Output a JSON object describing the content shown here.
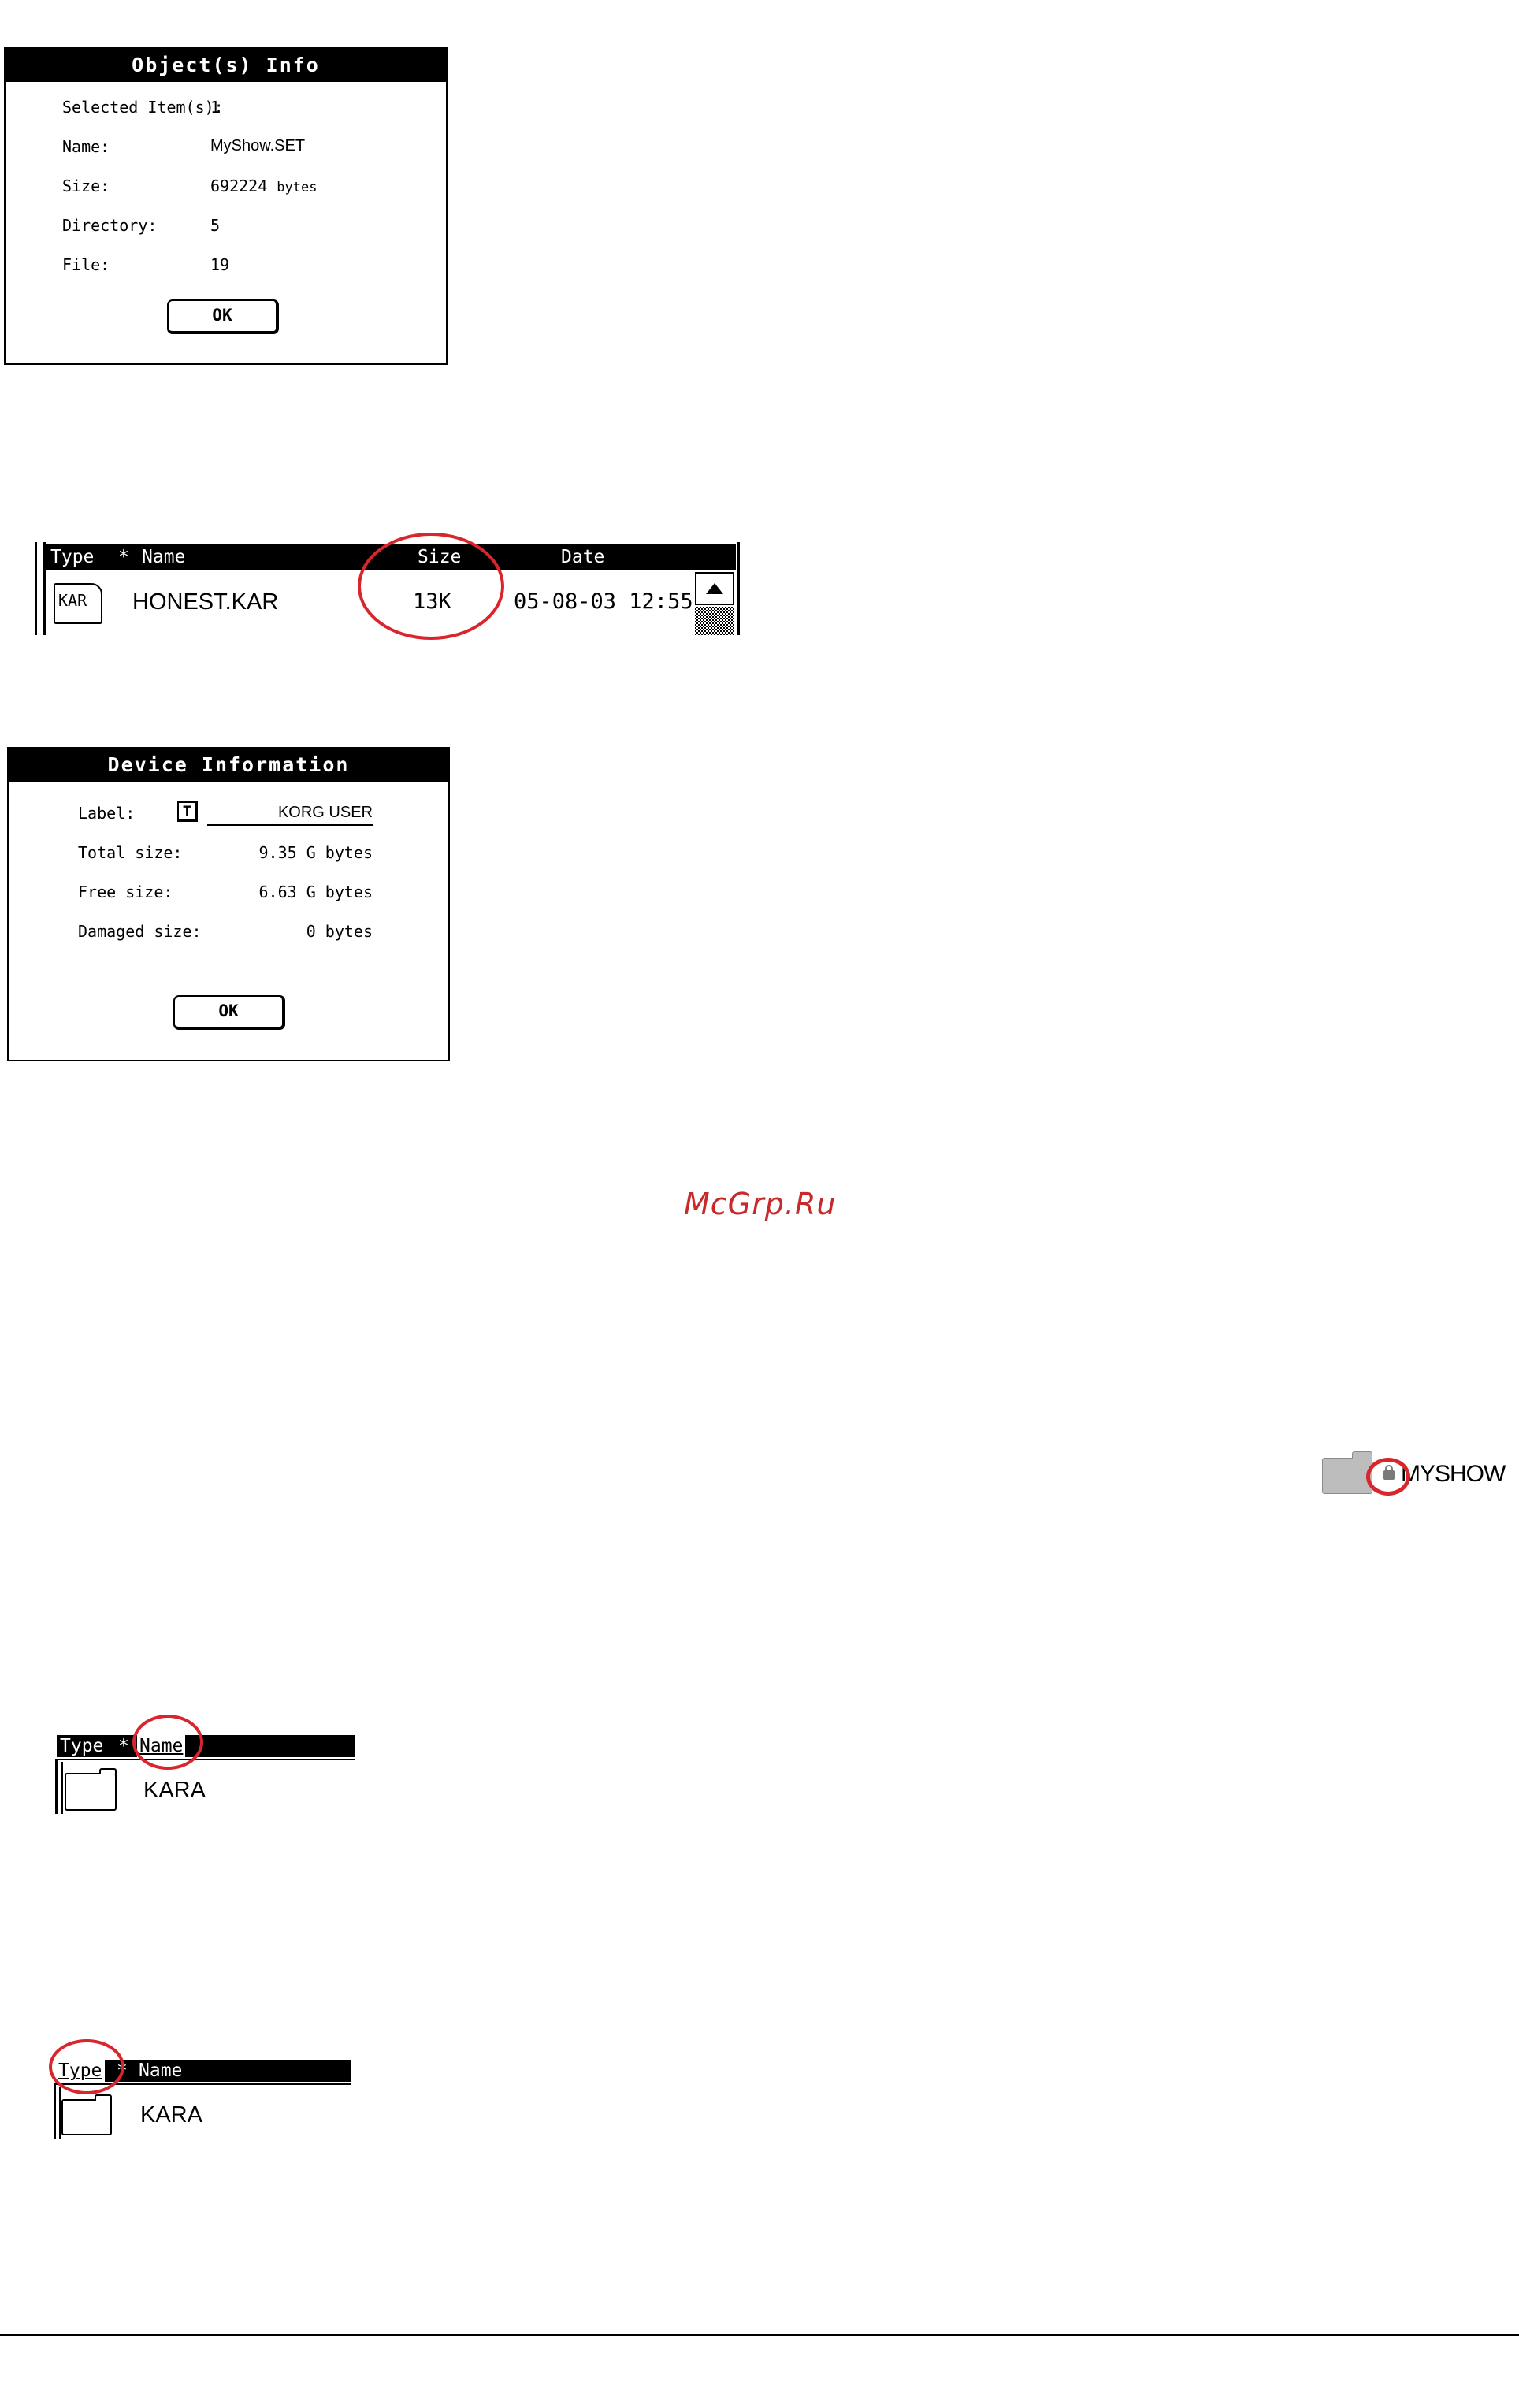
{
  "objects_info": {
    "title": "Object(s) Info",
    "fields": [
      {
        "label": "Selected Item(s):",
        "value": "1"
      },
      {
        "label": "Name:",
        "value": "MyShow.SET"
      },
      {
        "label": "Size:",
        "value": "692224",
        "unit": "bytes"
      },
      {
        "label": "Directory:",
        "value": "5"
      },
      {
        "label": "File:",
        "value": "19"
      }
    ],
    "ok_label": "OK"
  },
  "file_list_size": {
    "columns": [
      "Type",
      "*",
      "Name",
      "Size",
      "Date"
    ],
    "row": {
      "type_icon_text": "KAR",
      "name": "HONEST.KAR",
      "size": "13K",
      "date": "05-08-03 12:55"
    }
  },
  "device_info": {
    "title": "Device Information",
    "label_field": {
      "label": "Label:",
      "edit_icon": "T",
      "value": "KORG USER"
    },
    "fields": [
      {
        "label": "Total size:",
        "value": "9.35 G bytes"
      },
      {
        "label": "Free size:",
        "value": "6.63 G bytes"
      },
      {
        "label": "Damaged size:",
        "value": "0 bytes"
      }
    ],
    "ok_label": "OK"
  },
  "watermark": "McGrp.Ru",
  "locked_folder": {
    "name": "MYSHOW",
    "icon": "lock-icon"
  },
  "sort_by_name": {
    "columns": [
      "Type",
      "*",
      "Name"
    ],
    "row_name": "KARA"
  },
  "sort_by_type": {
    "columns": [
      "Type",
      "*",
      "Name"
    ],
    "row_name": "KARA"
  },
  "colors": {
    "highlight_circle": "#d8262c",
    "watermark": "#c62a2a"
  }
}
